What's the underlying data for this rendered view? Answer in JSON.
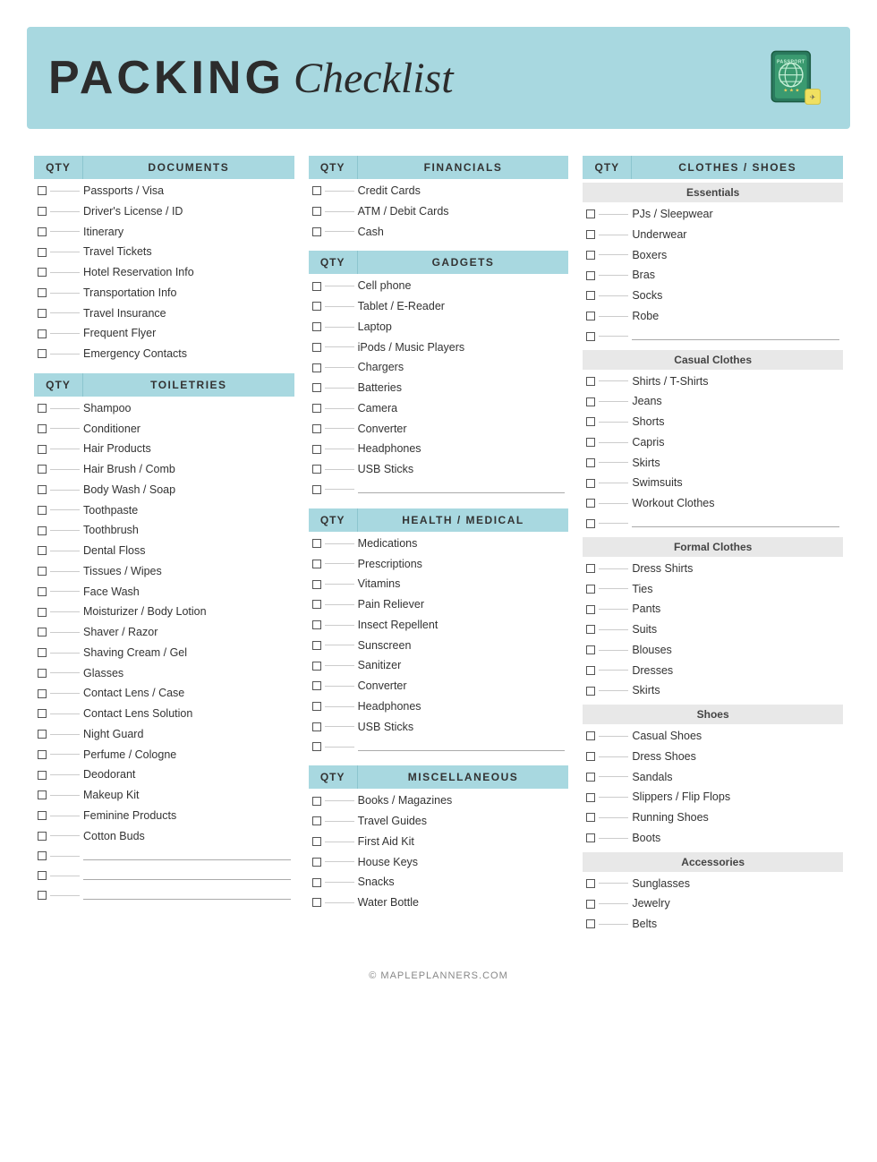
{
  "header": {
    "title_packing": "PACKING",
    "title_checklist": "Checklist"
  },
  "footer": {
    "text": "© MAPLEPLANNERS.COM"
  },
  "columns": [
    {
      "sections": [
        {
          "type": "section",
          "qty_label": "QTY",
          "title": "DOCUMENTS",
          "items": [
            "Passports / Visa",
            "Driver's License / ID",
            "Itinerary",
            "Travel Tickets",
            "Hotel Reservation Info",
            "Transportation Info",
            "Travel Insurance",
            "Frequent Flyer",
            "Emergency Contacts"
          ],
          "blanks": 0
        },
        {
          "type": "section",
          "qty_label": "QTY",
          "title": "TOILETRIES",
          "items": [
            "Shampoo",
            "Conditioner",
            "Hair Products",
            "Hair Brush / Comb",
            "Body Wash / Soap",
            "Toothpaste",
            "Toothbrush",
            "Dental Floss",
            "Tissues / Wipes",
            "Face Wash",
            "Moisturizer / Body Lotion",
            "Shaver / Razor",
            "Shaving Cream / Gel",
            "Glasses",
            "Contact Lens / Case",
            "Contact Lens Solution",
            "Night Guard",
            "Perfume / Cologne",
            "Deodorant",
            "Makeup Kit",
            "Feminine Products",
            "Cotton Buds"
          ],
          "blanks": 3
        }
      ]
    },
    {
      "sections": [
        {
          "type": "section",
          "qty_label": "QTY",
          "title": "FINANCIALS",
          "items": [
            "Credit Cards",
            "ATM / Debit Cards",
            "Cash"
          ],
          "blanks": 0
        },
        {
          "type": "section",
          "qty_label": "QTY",
          "title": "GADGETS",
          "items": [
            "Cell phone",
            "Tablet / E-Reader",
            "Laptop",
            "iPods / Music Players",
            "Chargers",
            "Batteries",
            "Camera",
            "Converter",
            "Headphones",
            "USB Sticks"
          ],
          "blanks": 1
        },
        {
          "type": "section",
          "qty_label": "QTY",
          "title": "HEALTH / MEDICAL",
          "items": [
            "Medications",
            "Prescriptions",
            "Vitamins",
            "Pain Reliever",
            "Insect Repellent",
            "Sunscreen",
            "Sanitizer",
            "Converter",
            "Headphones",
            "USB Sticks"
          ],
          "blanks": 1
        },
        {
          "type": "section",
          "qty_label": "QTY",
          "title": "MISCELLANEOUS",
          "items": [
            "Books / Magazines",
            "Travel Guides",
            "First Aid Kit",
            "House Keys",
            "Snacks",
            "Water Bottle"
          ],
          "blanks": 0
        }
      ]
    },
    {
      "sections": [
        {
          "type": "section",
          "qty_label": "QTY",
          "title": "CLOTHES / SHOES",
          "subsections": [
            {
              "label": "Essentials",
              "items": [
                "PJs / Sleepwear",
                "Underwear",
                "Boxers",
                "Bras",
                "Socks",
                "Robe"
              ],
              "blanks": 1
            },
            {
              "label": "Casual Clothes",
              "items": [
                "Shirts / T-Shirts",
                "Jeans",
                "Shorts",
                "Capris",
                "Skirts",
                "Swimsuits",
                "Workout Clothes"
              ],
              "blanks": 1
            },
            {
              "label": "Formal Clothes",
              "items": [
                "Dress Shirts",
                "Ties",
                "Pants",
                "Suits",
                "Blouses",
                "Dresses",
                "Skirts"
              ],
              "blanks": 0
            },
            {
              "label": "Shoes",
              "items": [
                "Casual Shoes",
                "Dress Shoes",
                "Sandals",
                "Slippers / Flip Flops",
                "Running Shoes",
                "Boots"
              ],
              "blanks": 0
            },
            {
              "label": "Accessories",
              "items": [
                "Sunglasses",
                "Jewelry",
                "Belts"
              ],
              "blanks": 0
            }
          ]
        }
      ]
    }
  ]
}
